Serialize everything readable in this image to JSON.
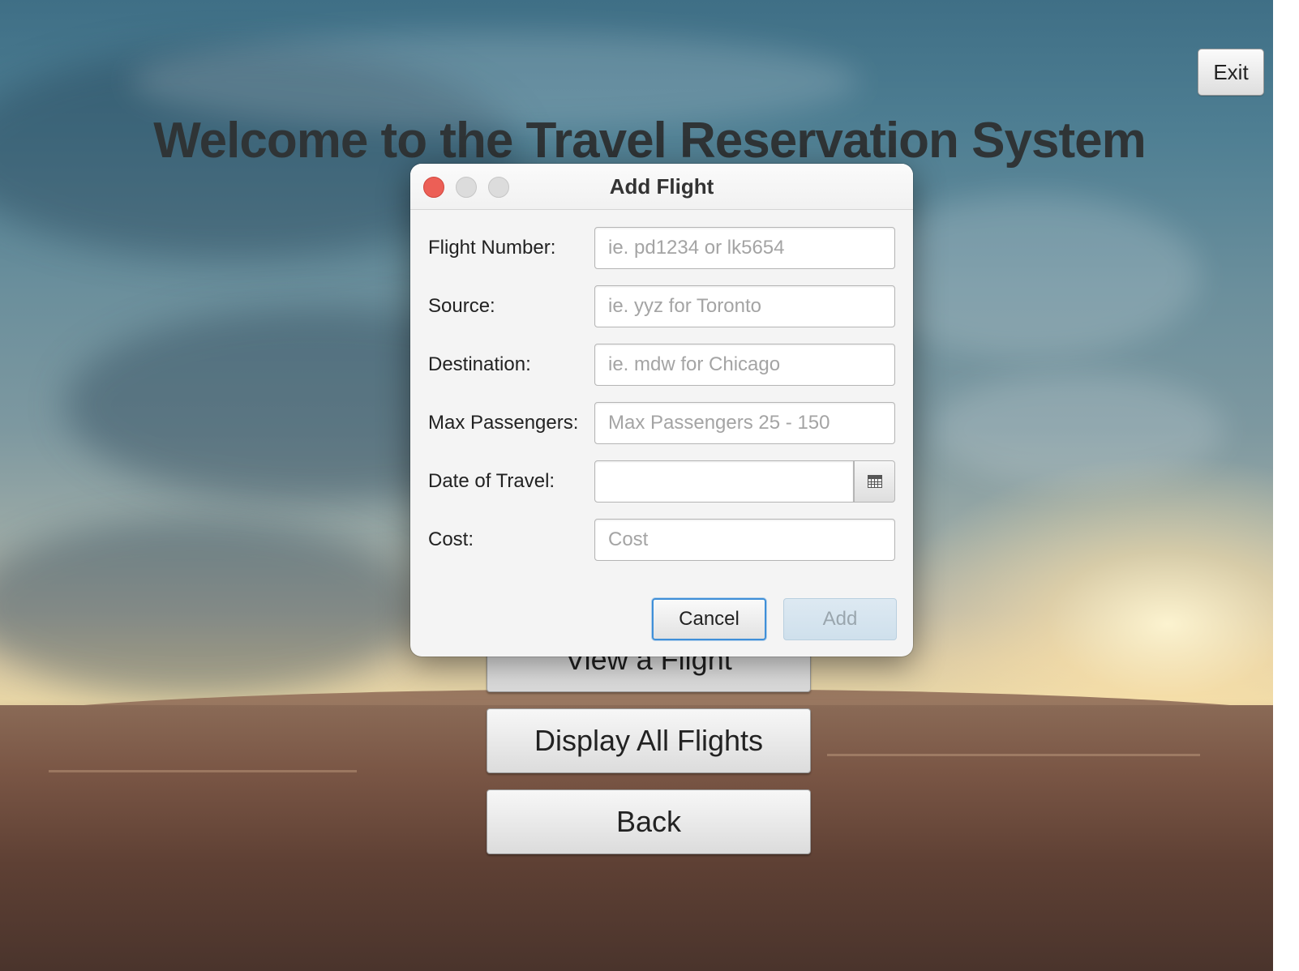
{
  "window": {
    "exit_label": "Exit"
  },
  "page": {
    "title": "Welcome to the Travel Reservation System",
    "buttons": {
      "view_flight": "View a Flight",
      "display_all": "Display All Flights",
      "back": "Back"
    }
  },
  "dialog": {
    "title": "Add Flight",
    "fields": {
      "flight_number": {
        "label": "Flight Number:",
        "value": "",
        "placeholder": "ie. pd1234 or lk5654"
      },
      "source": {
        "label": "Source:",
        "value": "",
        "placeholder": "ie. yyz for Toronto"
      },
      "destination": {
        "label": "Destination:",
        "value": "",
        "placeholder": "ie. mdw for Chicago"
      },
      "max_passengers": {
        "label": "Max Passengers:",
        "value": "",
        "placeholder": "Max Passengers 25 - 150"
      },
      "date_of_travel": {
        "label": "Date of Travel:",
        "value": "",
        "placeholder": "",
        "icon": "calendar-icon"
      },
      "cost": {
        "label": "Cost:",
        "value": "",
        "placeholder": "Cost"
      }
    },
    "cancel_label": "Cancel",
    "add_label": "Add",
    "add_enabled": false
  },
  "colors": {
    "close_button": "#ec5f56",
    "focus_ring": "#3f8fd8",
    "title_text": "#2f3436"
  }
}
